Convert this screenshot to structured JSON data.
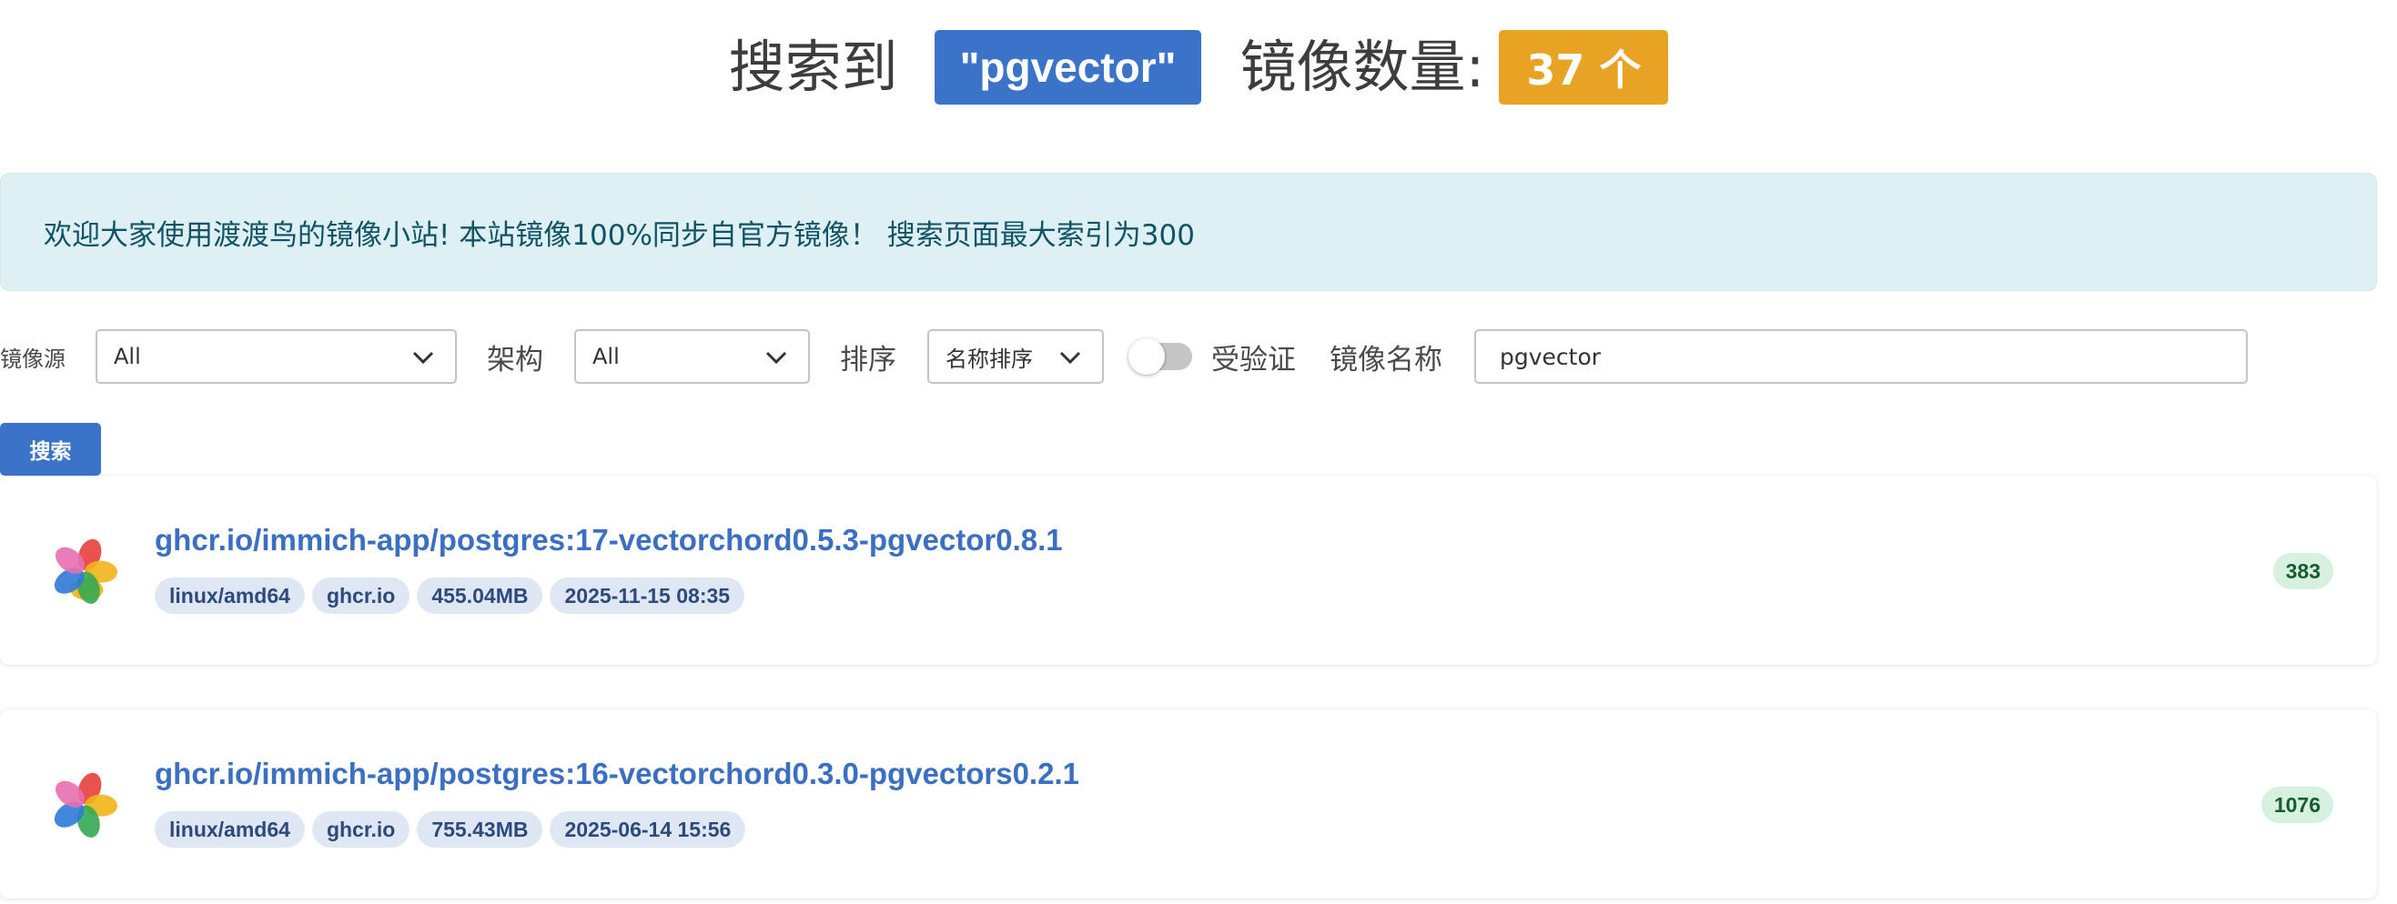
{
  "heading": {
    "prefix": "搜索到",
    "query": "\"pgvector\"",
    "count_label": "镜像数量:",
    "count": "37 个"
  },
  "notice": {
    "text": "欢迎大家使用渡渡鸟的镜像小站! 本站镜像100%同步自官方镜像！ 搜索页面最大索引为300"
  },
  "filters": {
    "source_label": "镜像源",
    "source_value": "All",
    "arch_label": "架构",
    "arch_value": "All",
    "sort_label": "排序",
    "sort_value": "名称排序",
    "verified_label": "受验证",
    "verified_on": false,
    "name_label": "镜像名称",
    "name_value": "pgvector"
  },
  "search_button": "搜索",
  "colors": {
    "primary": "#3b73c9",
    "count_badge": "#e8a324",
    "notice_bg": "#dff0f5",
    "tag_bg": "#dfe7f5",
    "pull_badge_bg": "#d6f1df"
  },
  "results": [
    {
      "icon": "pinwheel-logo-icon",
      "title": "ghcr.io/immich-app/postgres:17-vectorchord0.5.3-pgvector0.8.1",
      "platform": "linux/amd64",
      "registry": "ghcr.io",
      "size": "455.04MB",
      "updated": "2025-11-15 08:35",
      "pulls": "383"
    },
    {
      "icon": "pinwheel-logo-icon",
      "title": "ghcr.io/immich-app/postgres:16-vectorchord0.3.0-pgvectors0.2.1",
      "platform": "linux/amd64",
      "registry": "ghcr.io",
      "size": "755.43MB",
      "updated": "2025-06-14 15:56",
      "pulls": "1076"
    }
  ]
}
